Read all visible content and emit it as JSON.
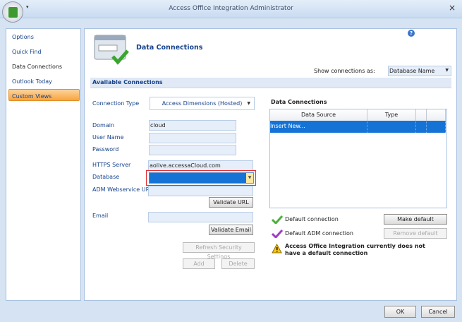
{
  "window": {
    "title": "Access Office Integration Administrator",
    "close": "×",
    "qat": "▾"
  },
  "sidebar": {
    "items": [
      {
        "label": "Options"
      },
      {
        "label": "Quick Find"
      },
      {
        "label": "Data Connections",
        "selected": true
      },
      {
        "label": "Outlook Today"
      },
      {
        "label": "Custom Views"
      }
    ]
  },
  "header": {
    "title": "Data Connections",
    "help": "?",
    "show_as_label": "Show connections as:",
    "show_as_value": "Database Name"
  },
  "section": {
    "title": "Available Connections"
  },
  "form": {
    "connection_type_label": "Connection Type",
    "connection_type_value": "Access Dimensions (Hosted)",
    "domain_label": "Domain",
    "domain_value": "cloud",
    "username_label": "User Name",
    "username_value": "",
    "password_label": "Password",
    "password_value": "",
    "https_label": "HTTPS Server",
    "https_value": "aolive.accessaCloud.com",
    "database_label": "Database",
    "database_value": "",
    "adm_label": "ADM Webservice URL",
    "adm_value": "",
    "validate_url": "Validate URL",
    "email_label": "Email",
    "email_value": "",
    "validate_email": "Validate Email",
    "refresh": "Refresh Security Settings",
    "add": "Add",
    "delete": "Delete"
  },
  "connections": {
    "title": "Data Connections",
    "columns": [
      "Data Source",
      "Type",
      "",
      ""
    ],
    "rows": [
      {
        "source": "Insert New...",
        "type": ""
      }
    ]
  },
  "legend": {
    "default": "Default connection",
    "default_adm": "Default ADM connection",
    "make_default": "Make default",
    "remove_default": "Remove default",
    "warning": "Access Office Integration currently does not have a default connection"
  },
  "colors": {
    "selected_row": "#1673d6",
    "nav_selected": "#f8a43e",
    "highlight_border": "#e03030"
  },
  "footer": {
    "ok": "OK",
    "cancel": "Cancel"
  }
}
